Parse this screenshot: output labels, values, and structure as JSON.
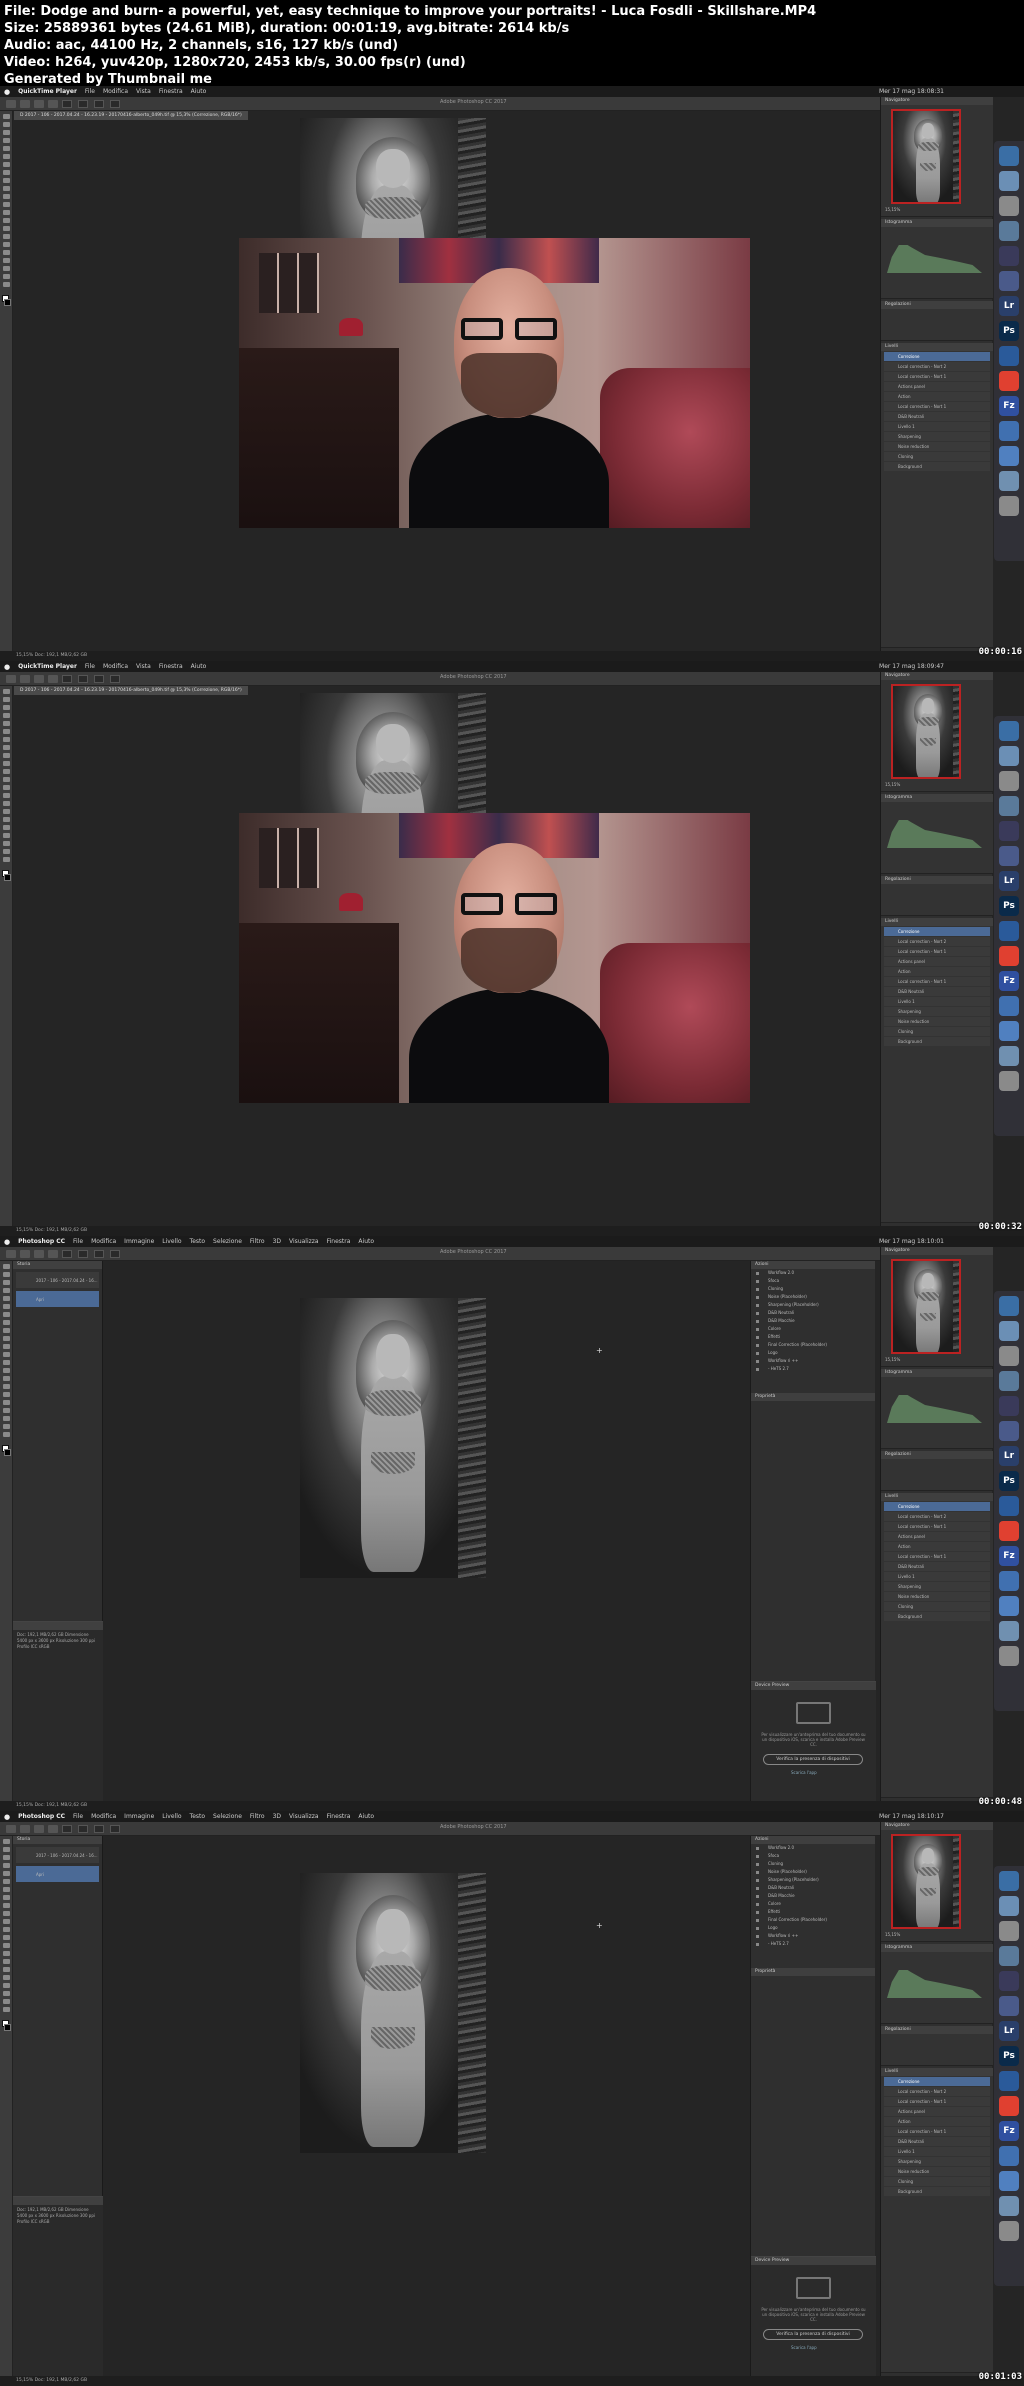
{
  "info": {
    "line1": "File: Dodge and burn- a powerful, yet, easy technique to improve your portraits! - Luca Fosdli - Skillshare.MP4",
    "line2": "Size: 25889361 bytes (24.61 MiB), duration: 00:01:19, avg.bitrate: 2614 kb/s",
    "line3": "Audio: aac, 44100 Hz, 2 channels, s16, 127 kb/s (und)",
    "line4": "Video: h264, yuv420p, 1280x720, 2453 kb/s, 30.00 fps(r) (und)",
    "line5": "Generated by Thumbnail me"
  },
  "frames": [
    {
      "app_name": "QuickTime Player",
      "menus": [
        "File",
        "Modifica",
        "Vista",
        "Finestra",
        "Aiuto"
      ],
      "clock": "Mer 17 mag 18:08:31",
      "window_title": "Adobe Photoshop CC 2017",
      "doc_tab": "D 2017 - 106 - 2017.04.24 - 16.23.19 - 20170416-alberto_049h.tif @ 15,3% (Correzione, RGB/16*)",
      "timestamp": "00:00:16"
    },
    {
      "app_name": "QuickTime Player",
      "menus": [
        "File",
        "Modifica",
        "Vista",
        "Finestra",
        "Aiuto"
      ],
      "clock": "Mer 17 mag 18:09:47",
      "window_title": "Adobe Photoshop CC 2017",
      "doc_tab": "D 2017 - 106 - 2017.04.24 - 16.23.19 - 20170416-alberto_049h.tif @ 15,3% (Correzione, RGB/16*)",
      "timestamp": "00:00:32"
    },
    {
      "app_name": "Photoshop CC",
      "menus": [
        "File",
        "Modifica",
        "Immagine",
        "Livello",
        "Testo",
        "Selezione",
        "Filtro",
        "3D",
        "Visualizza",
        "Finestra",
        "Aiuto"
      ],
      "clock": "Mer 17 mag 18:10:01",
      "window_title": "Adobe Photoshop CC 2017",
      "doc_tab": "",
      "timestamp": "00:00:48"
    },
    {
      "app_name": "Photoshop CC",
      "menus": [
        "File",
        "Modifica",
        "Immagine",
        "Livello",
        "Testo",
        "Selezione",
        "Filtro",
        "3D",
        "Visualizza",
        "Finestra",
        "Aiuto"
      ],
      "clock": "Mer 17 mag 18:10:17",
      "window_title": "Adobe Photoshop CC 2017",
      "doc_tab": "",
      "timestamp": "00:01:03"
    }
  ],
  "panels": {
    "navigator": "Navigatore",
    "histogram": "Istogramma",
    "adjustments": "Regolazioni",
    "layers": "Livelli",
    "history": "Storia",
    "actions": "Azioni",
    "properties": "Proprietà",
    "device_preview": "Device Preview",
    "device_btn": "Verifica la presenza di dispositivi",
    "device_link": "Scarica l'app",
    "device_desc": "Per visualizzare un'anteprima del tuo documento su un dispositivo iOS, scarica e installa Adobe Preview CC.",
    "zoom": "15,15%",
    "statusbar": "15,15%  Doc: 192,1 MB/2,62 GB",
    "layer_names": [
      "Correzione",
      "Local correction - Nort 2",
      "Local correction - Nort 1",
      "Actions panel",
      "Action",
      "Local correction - Nort 1",
      "D&B Neutrali",
      "Livello 1",
      "Sharpening",
      "Noise reduction",
      "Cloning",
      "Background"
    ],
    "action_names": [
      "Workflow 2.0",
      "Sfoca",
      "Cloning",
      "Noise (Placeholder)",
      "Sharpening (Placeholder)",
      "D&B Neutrali",
      "D&B Macchie",
      "Colore",
      "Effetti",
      "Final Correction (Placeholder)",
      "Logo",
      "Workflow ri ++",
      "- HeTS 2.7"
    ],
    "history_item": "2017 - 106 - 2017.04.24 - 16...",
    "history_sub": "Apri",
    "info_text": "Doc: 192,1 MB/2,62 GB  Dimensione 5400 px x 3600 px  Risoluzione 300 ppi  Profilo ICC sRGB"
  },
  "dock": {
    "icons": [
      "Lr",
      "Ps",
      "Fz"
    ]
  },
  "colors": {
    "panel_bg": "#2f2f2f",
    "canvas_bg": "#252525",
    "selected": "#4b6a96",
    "nav_border": "#bb2222",
    "timestamp": "#ffffff"
  }
}
